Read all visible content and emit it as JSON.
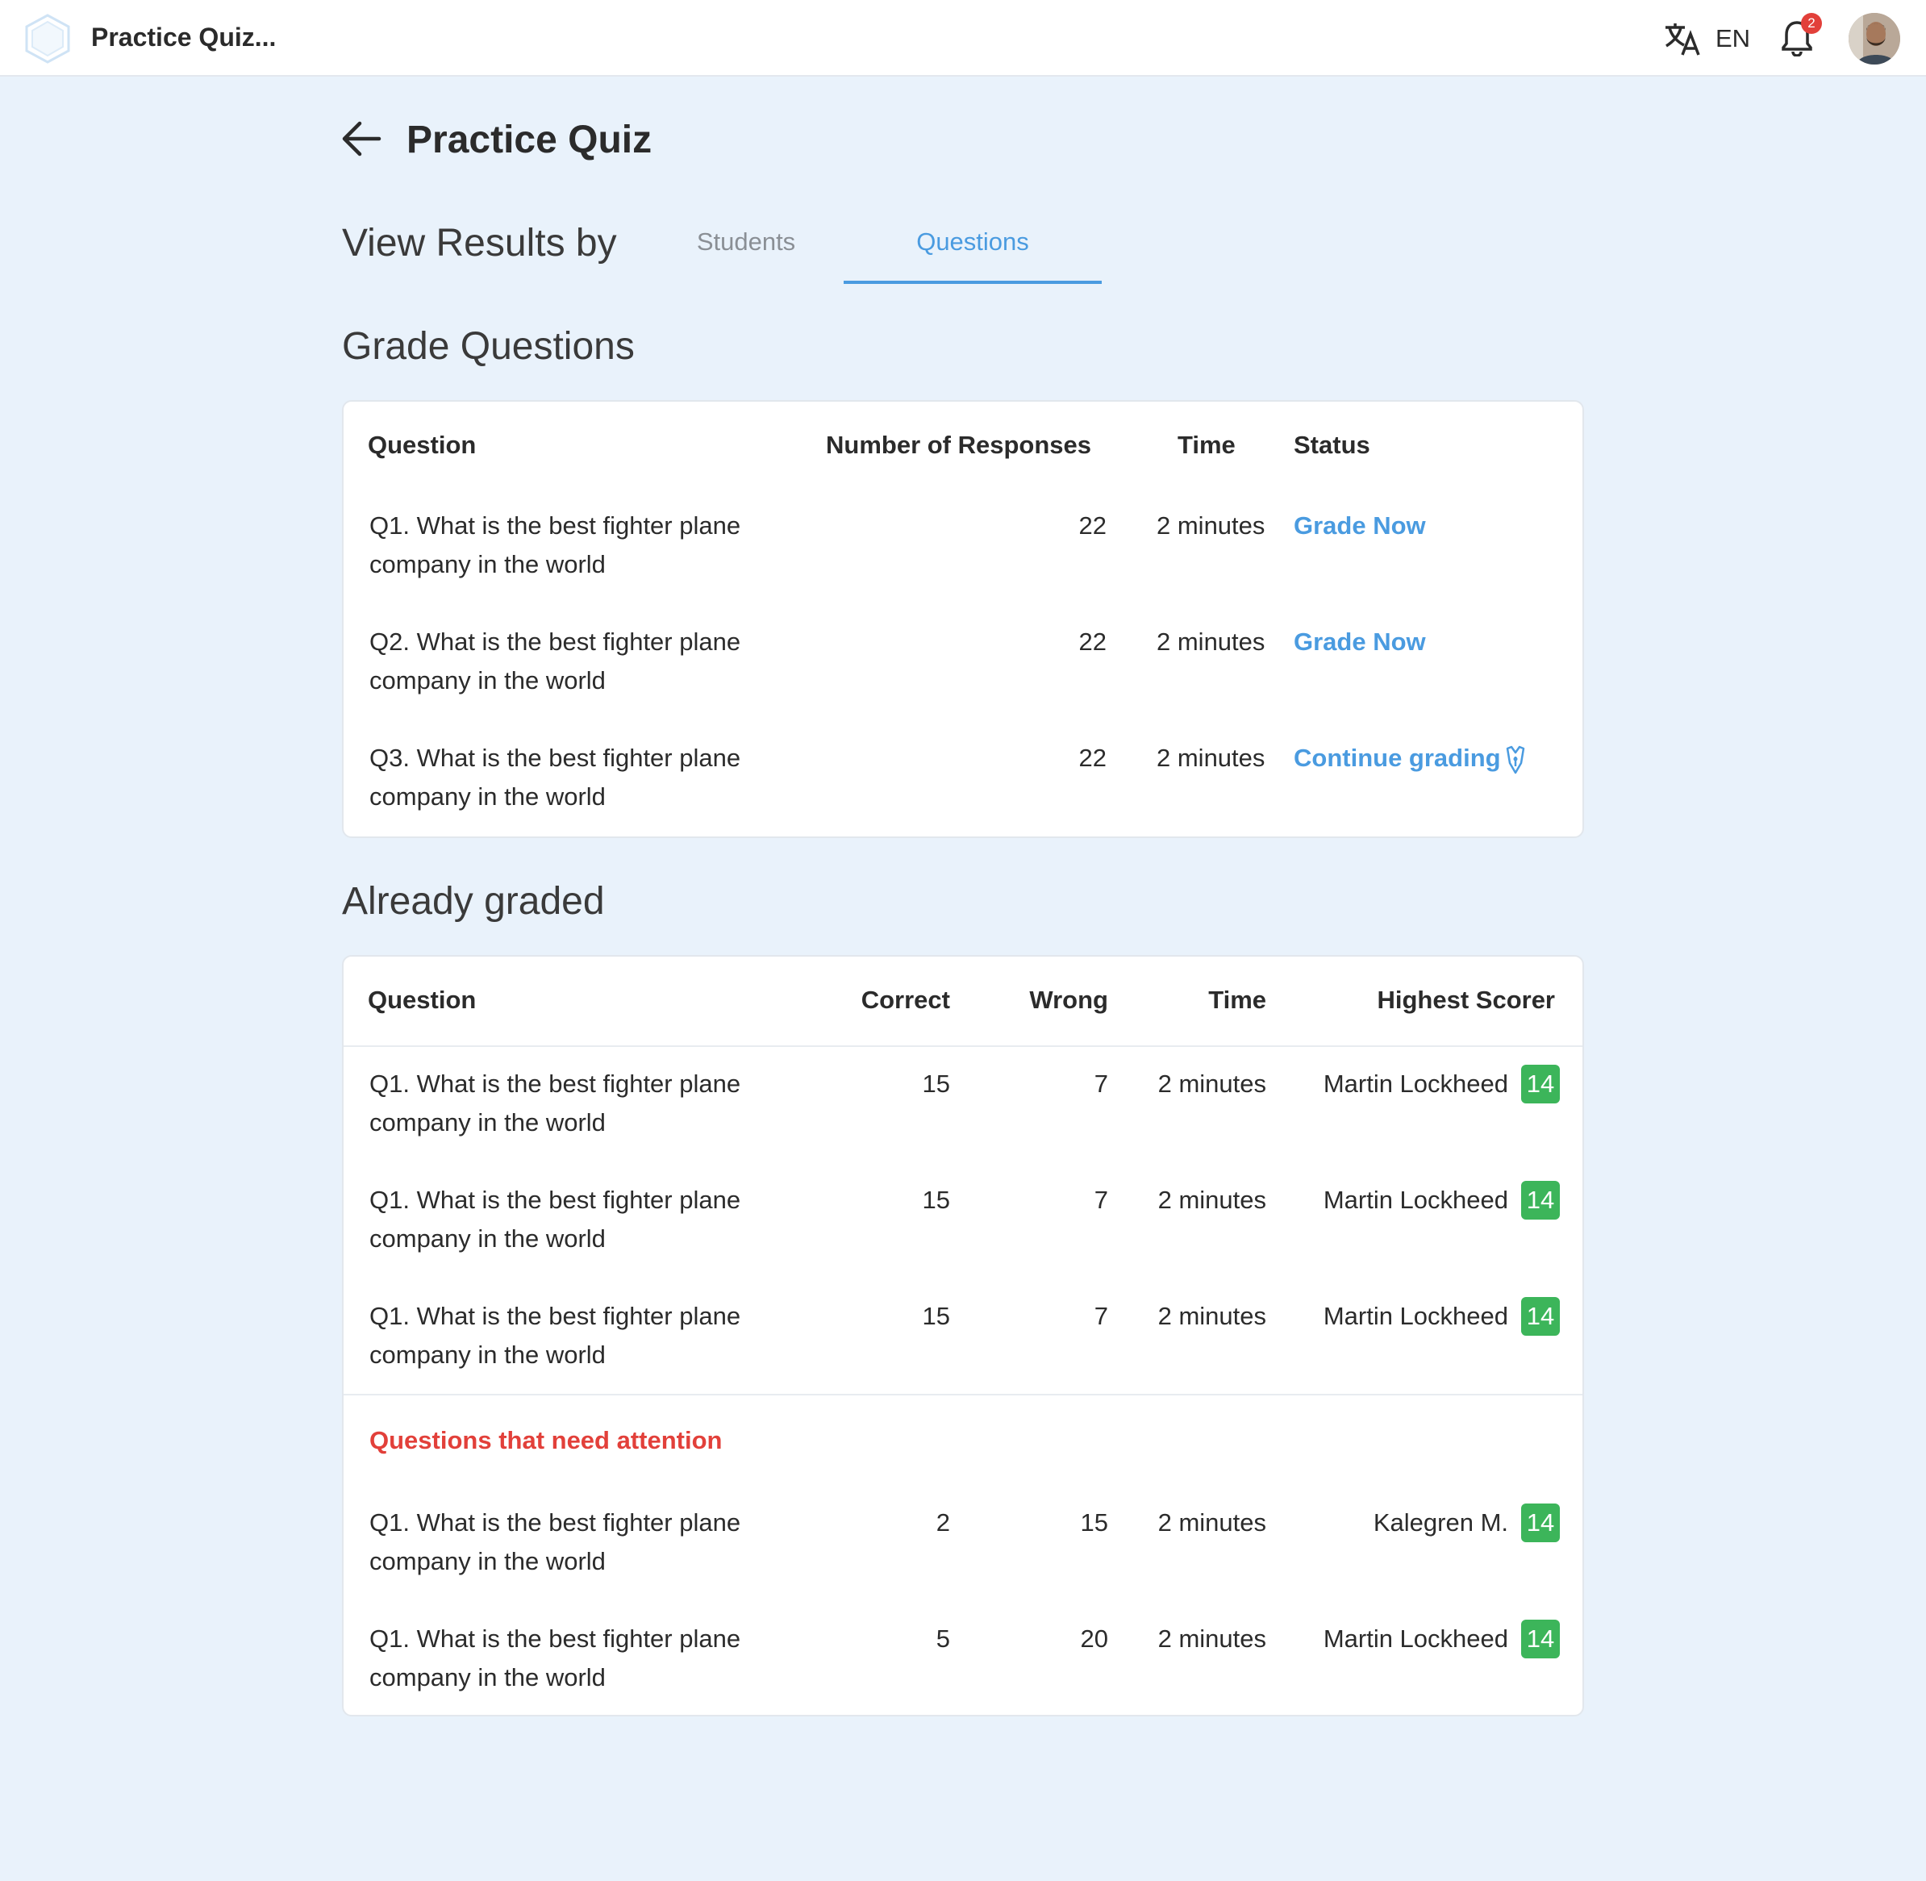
{
  "header": {
    "app_title": "Practice Quiz...",
    "language": "EN",
    "notification_count": "2"
  },
  "page": {
    "title": "Practice Quiz",
    "view_results_by": "View Results by",
    "tabs": [
      {
        "label": "Students",
        "active": false
      },
      {
        "label": "Questions",
        "active": true
      }
    ]
  },
  "grade_section": {
    "title": "Grade Questions",
    "columns": [
      "Question",
      "Number of Responses",
      "Time",
      "Status"
    ],
    "rows": [
      {
        "question": "Q1. What is the best fighter plane company in the world",
        "responses": "22",
        "time": "2 minutes",
        "status": "Grade Now"
      },
      {
        "question": "Q2. What is the best fighter plane company in the world",
        "responses": "22",
        "time": "2 minutes",
        "status": "Grade Now"
      },
      {
        "question": "Q3. What is the best fighter plane company in the world",
        "responses": "22",
        "time": "2 minutes",
        "status": "Continue grading"
      }
    ]
  },
  "graded_section": {
    "title": "Already graded",
    "columns": [
      "Question",
      "Correct",
      "Wrong",
      "Time",
      "Highest Scorer"
    ],
    "rows": [
      {
        "question": "Q1. What is the best fighter plane company in the world",
        "correct": "15",
        "wrong": "7",
        "time": "2 minutes",
        "scorer": "Martin Lockheed",
        "score": "14"
      },
      {
        "question": "Q1. What is the best fighter plane company in the world",
        "correct": "15",
        "wrong": "7",
        "time": "2 minutes",
        "scorer": "Martin Lockheed",
        "score": "14"
      },
      {
        "question": "Q1. What is the best fighter plane company in the world",
        "correct": "15",
        "wrong": "7",
        "time": "2 minutes",
        "scorer": "Martin Lockheed",
        "score": "14"
      }
    ],
    "attention_label": "Questions that need attention",
    "attention_rows": [
      {
        "question": "Q1. What is the best fighter plane company in the world",
        "correct": "2",
        "wrong": "15",
        "time": "2 minutes",
        "scorer": "Kalegren M.",
        "score": "14"
      },
      {
        "question": "Q1. What is the best fighter plane company in the world",
        "correct": "5",
        "wrong": "20",
        "time": "2 minutes",
        "scorer": "Martin Lockheed",
        "score": "14"
      }
    ]
  },
  "colors": {
    "accent": "#4a9be0",
    "attention": "#e2403a",
    "badge": "#3cb55a",
    "background": "#e9f2fb"
  }
}
